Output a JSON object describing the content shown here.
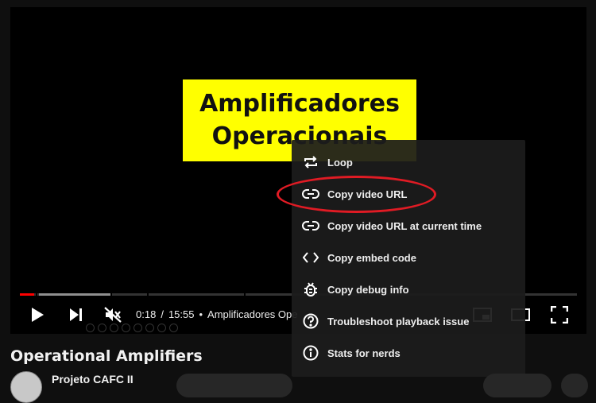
{
  "slide": {
    "line1": "Amplificadores",
    "line2": "Operacionais"
  },
  "player": {
    "time_current": "0:18",
    "time_separator": "/",
    "time_total": "15:55",
    "bullet": "•",
    "chapter_title": "Amplificadores Ope",
    "progress_played_fraction": 0.025
  },
  "context_menu": {
    "items": [
      {
        "label": "Loop",
        "icon": "loop-icon"
      },
      {
        "label": "Copy video URL",
        "icon": "link-icon"
      },
      {
        "label": "Copy video URL at current time",
        "icon": "link-icon"
      },
      {
        "label": "Copy embed code",
        "icon": "code-icon"
      },
      {
        "label": "Copy debug info",
        "icon": "bug-icon"
      },
      {
        "label": "Troubleshoot playback issue",
        "icon": "question-icon"
      },
      {
        "label": "Stats for nerds",
        "icon": "info-icon"
      }
    ]
  },
  "video": {
    "title": "Operational Amplifiers",
    "channel_name": "Projeto CAFC II"
  },
  "colors": {
    "accent_red": "#ff0000",
    "annotation_red": "#e01b24",
    "slide_yellow": "#ffff00"
  }
}
